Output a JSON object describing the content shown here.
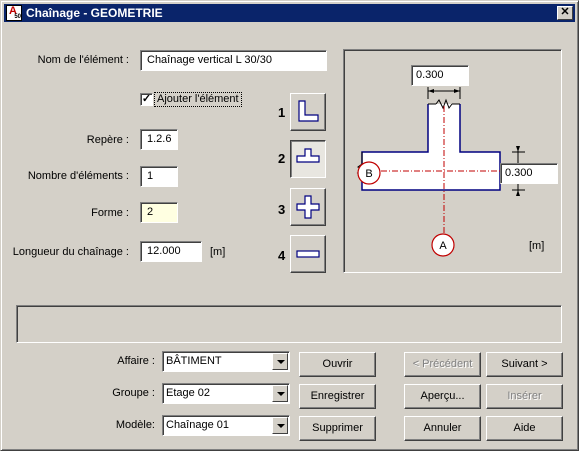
{
  "window": {
    "title": "Chaînage - GEOMETRIE",
    "close_glyph": "✕",
    "icon": "app-logo-icon",
    "icon_letters": "A",
    "icon_small": "50"
  },
  "form": {
    "element_name_label": "Nom de l'élément :",
    "element_name_value": "Chaînage vertical  L 30/30",
    "add_element_checked": true,
    "add_element_check_glyph": "✓",
    "add_element_label": "Ajouter l'élément",
    "repere_label": "Repère :",
    "repere_value": "1.2.6",
    "count_label": "Nombre d'éléments :",
    "count_value": "1",
    "shape_label": "Forme :",
    "shape_value": "2",
    "length_label": "Longueur du chaînage :",
    "length_value": "12.000",
    "length_unit": "[m]"
  },
  "shapes": [
    {
      "number": "1",
      "icon": "l-shape-icon",
      "selected": false
    },
    {
      "number": "2",
      "icon": "t-shape-icon",
      "selected": true
    },
    {
      "number": "3",
      "icon": "cross-shape-icon",
      "selected": false
    },
    {
      "number": "4",
      "icon": "straight-shape-icon",
      "selected": false
    }
  ],
  "diagram": {
    "width_value": "0.300",
    "depth_value": "0.300",
    "axis_a": "A",
    "axis_b": "B",
    "unit": "[m]"
  },
  "status": {
    "message": ""
  },
  "bottom": {
    "affaire_label": "Affaire :",
    "affaire_value": "BÂTIMENT",
    "groupe_label": "Groupe :",
    "groupe_value": "Etage 02",
    "modele_label": "Modèle:",
    "modele_value": "Chaînage 01"
  },
  "buttons": {
    "open": "Ouvrir",
    "save": "Enregistrer",
    "delete": "Supprimer",
    "previous": "< Précédent",
    "next": "Suivant  >",
    "preview": "Aperçu...",
    "insert": "Insérer",
    "cancel": "Annuler",
    "help": "Aide"
  },
  "colors": {
    "title_bar": "#0a246a",
    "outline": "#000080",
    "axis": "#c00000",
    "face": "#d4d0c8"
  }
}
